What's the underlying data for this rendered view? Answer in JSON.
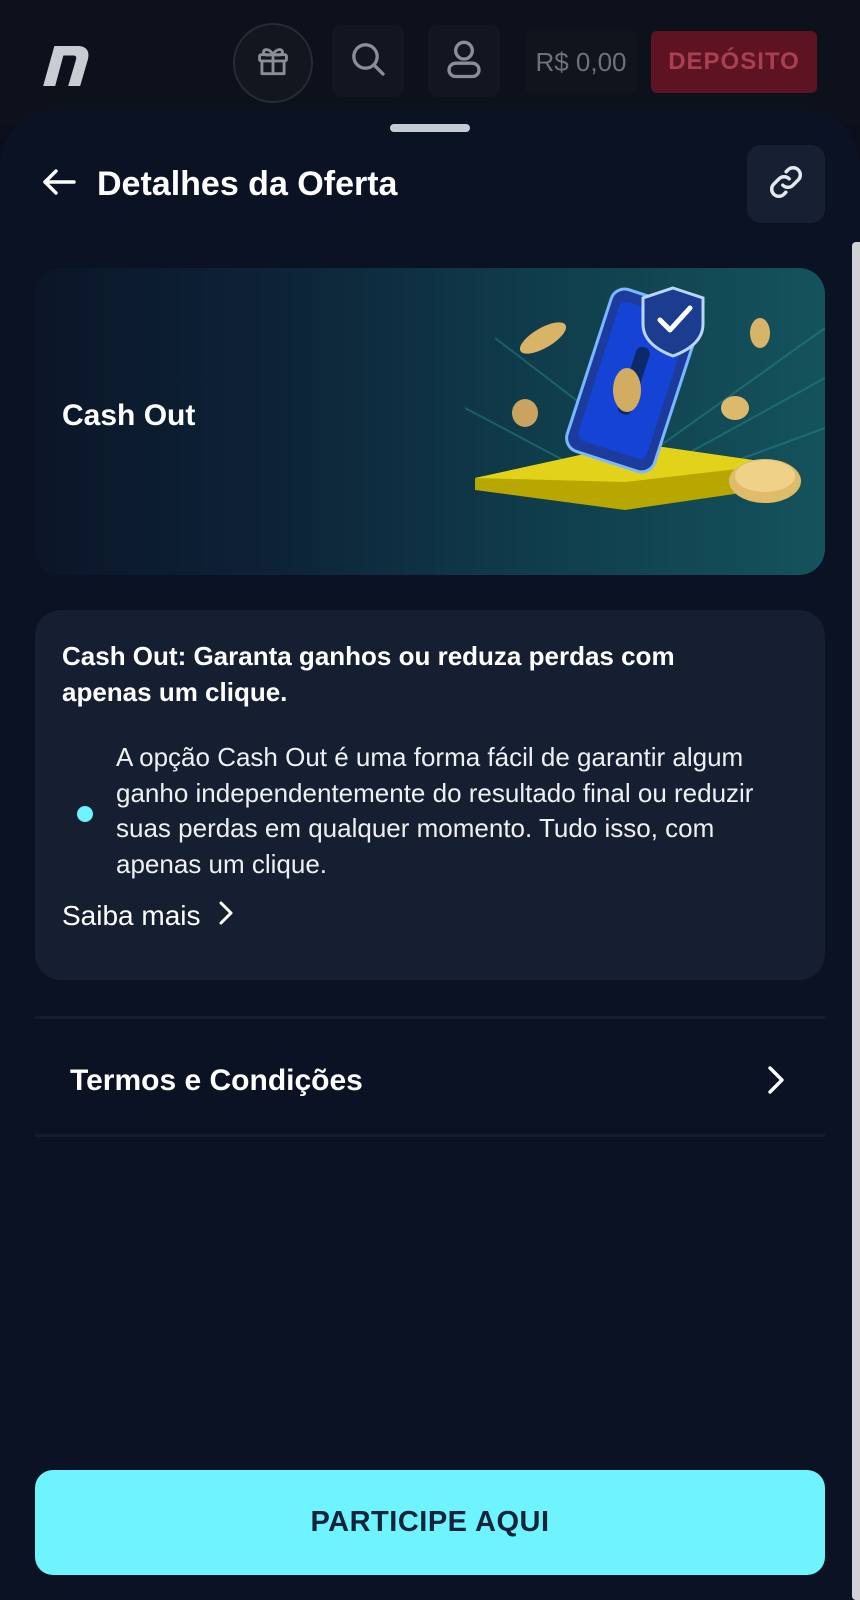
{
  "topbar": {
    "logo_icon": "n-logo-icon",
    "gift_icon": "gift-icon",
    "search_icon": "search-icon",
    "user_icon": "user-icon",
    "balance": "R$ 0,00",
    "deposit_label": "DEPÓSITO",
    "deposit_color": "#5e1322"
  },
  "sheet": {
    "header": {
      "back_icon": "arrow-left-icon",
      "title": "Detalhes da Oferta",
      "link_icon": "link-icon"
    },
    "banner": {
      "title": "Cash Out"
    },
    "offer_card": {
      "title": "Cash Out: Garanta ganhos ou reduza perdas com apenas um clique.",
      "bullet_text": "A opção Cash Out é uma forma fácil de garantir algum ganho independentemente do resultado final ou reduzir suas perdas em qualquer momento. Tudo isso, com apenas um clique.",
      "more_label": "Saiba mais"
    },
    "terms": {
      "label": "Termos e Condições"
    },
    "cta": {
      "label": "PARTICIPE AQUI",
      "color": "#6df4ff"
    }
  }
}
